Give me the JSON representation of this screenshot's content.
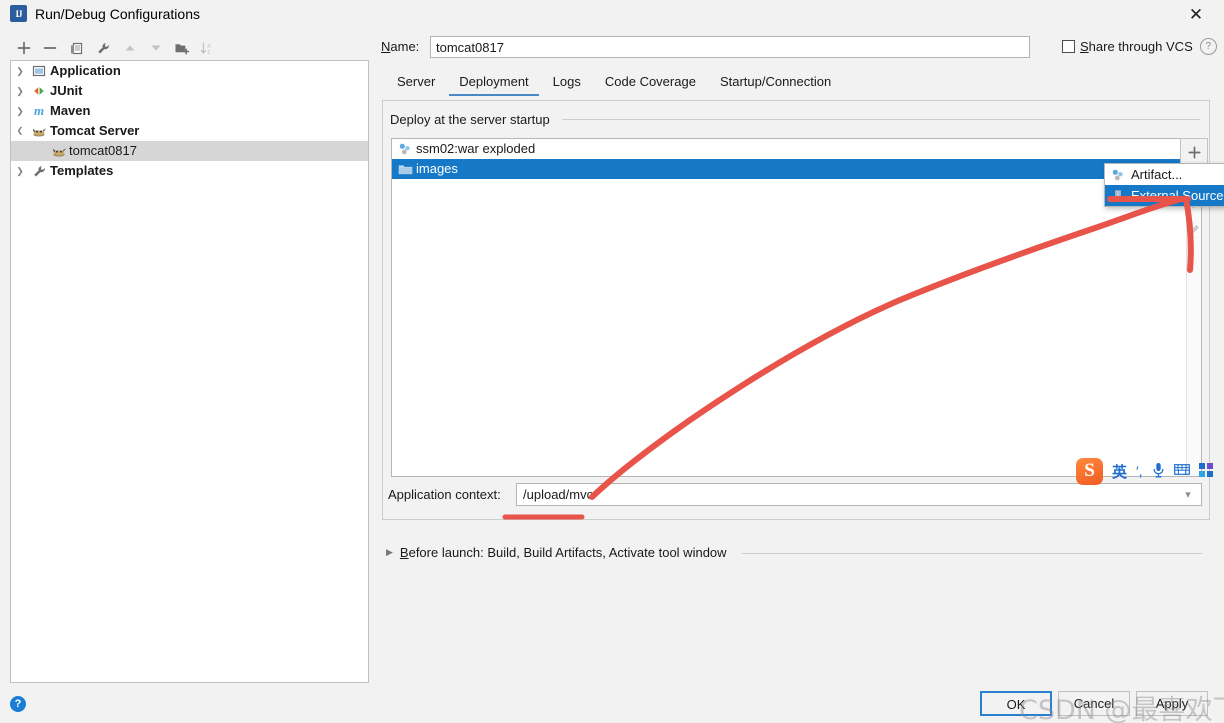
{
  "window": {
    "title": "Run/Debug Configurations",
    "app_icon": "intellij-idea-icon",
    "close_icon": "close-icon"
  },
  "left_toolbar": {
    "buttons": [
      {
        "name": "add-configuration-button",
        "icon": "plus-icon",
        "label": "+",
        "enabled": true
      },
      {
        "name": "remove-configuration-button",
        "icon": "minus-icon",
        "label": "−",
        "enabled": true
      },
      {
        "name": "copy-configuration-button",
        "icon": "copy-icon",
        "label": "copy",
        "enabled": true
      },
      {
        "name": "edit-templates-button",
        "icon": "wrench-icon",
        "label": "wrench",
        "enabled": true
      },
      {
        "name": "move-up-button",
        "icon": "arrow-up-icon",
        "label": "up",
        "enabled": false
      },
      {
        "name": "move-down-button",
        "icon": "arrow-down-icon",
        "label": "down",
        "enabled": false
      },
      {
        "name": "move-into-folder-button",
        "icon": "new-folder-icon",
        "label": "folder",
        "enabled": true
      },
      {
        "name": "sort-configurations-button",
        "icon": "sort-az-icon",
        "label": "sort",
        "enabled": false
      }
    ]
  },
  "tree": {
    "nodes": [
      {
        "label": "Application",
        "icon": "application-icon",
        "expanded": false,
        "has_arrow": true,
        "selected": false,
        "child": false
      },
      {
        "label": "JUnit",
        "icon": "junit-icon",
        "expanded": false,
        "has_arrow": true,
        "selected": false,
        "child": false
      },
      {
        "label": "Maven",
        "icon": "maven-icon",
        "expanded": false,
        "has_arrow": true,
        "selected": false,
        "child": false
      },
      {
        "label": "Tomcat Server",
        "icon": "tomcat-icon",
        "expanded": true,
        "has_arrow": true,
        "selected": false,
        "child": false
      },
      {
        "label": "tomcat0817",
        "icon": "tomcat-icon",
        "expanded": false,
        "has_arrow": false,
        "selected": true,
        "child": true
      },
      {
        "label": "Templates",
        "icon": "wrench-icon",
        "expanded": false,
        "has_arrow": true,
        "selected": false,
        "child": false
      }
    ]
  },
  "name_field": {
    "label": "Name:",
    "label_mnemonic": "N",
    "value": "tomcat0817",
    "placeholder": ""
  },
  "share": {
    "label": "Share through VCS",
    "label_mnemonic": "S",
    "checked": false,
    "help_icon": "question-mark-icon",
    "help_label": "?"
  },
  "tabs": [
    {
      "label": "Server",
      "active": false
    },
    {
      "label": "Deployment",
      "active": true
    },
    {
      "label": "Logs",
      "active": false
    },
    {
      "label": "Code Coverage",
      "active": false
    },
    {
      "label": "Startup/Connection",
      "active": false
    }
  ],
  "deployment": {
    "group_title": "Deploy at the server startup",
    "rows": [
      {
        "label": "ssm02:war exploded",
        "icon": "artifact-icon",
        "selected": false
      },
      {
        "label": "images",
        "icon": "folder-icon",
        "selected": true
      }
    ],
    "side_toolbar": [
      {
        "name": "add-deployment-button",
        "icon": "plus-icon",
        "label": "+",
        "enabled": true
      },
      {
        "name": "remove-deployment-button",
        "icon": "minus-icon",
        "label": "−",
        "enabled": true
      },
      {
        "name": "move-deployment-down-button",
        "icon": "arrow-down-icon",
        "label": "down",
        "enabled": false
      },
      {
        "name": "edit-deployment-button",
        "icon": "pencil-icon",
        "label": "edit",
        "enabled": false
      }
    ],
    "popup_menu": {
      "items": [
        {
          "label": "Artifact...",
          "icon": "artifact-icon",
          "selected": false
        },
        {
          "label": "External Source...",
          "icon": "external-source-icon",
          "selected": true
        }
      ]
    }
  },
  "app_context": {
    "label": "Application context:",
    "value": "/upload/mvc",
    "placeholder": "",
    "chevron_icon": "chevron-down-icon"
  },
  "before_launch": {
    "expand_icon": "triangle-right-icon",
    "label": "Before launch: Build, Build Artifacts, Activate tool window",
    "label_mnemonic": "B"
  },
  "bottom": {
    "help_icon": "question-mark-icon",
    "help_label": "?",
    "buttons": [
      {
        "label": "OK",
        "primary": true,
        "name": "ok-button"
      },
      {
        "label": "Cancel",
        "primary": false,
        "name": "cancel-button"
      },
      {
        "label": "Apply",
        "primary": false,
        "name": "apply-button"
      }
    ]
  },
  "ime_toolbar": {
    "logo_label": "S",
    "mode_label": "英",
    "punctuation_label": "′,",
    "mic_icon": "microphone-icon",
    "keyboard_icon": "keyboard-icon",
    "apps_icon": "apps-grid-icon"
  },
  "watermark": {
    "text": "CSDN @最喜欢飞机"
  },
  "annotation": {
    "color": "#e8534a",
    "description": "hand-drawn arrow from application context field to External Source menu item"
  },
  "colors": {
    "selection_blue": "#1679c8",
    "tab_underline": "#4a88c7",
    "dialog_bg": "#f2f2f2",
    "tree_selection_gray": "#d6d6d6",
    "annotation_red": "#e8534a"
  }
}
